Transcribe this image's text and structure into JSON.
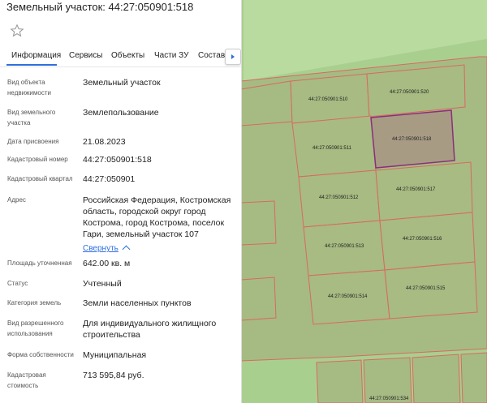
{
  "title": "Земельный участок: 44:27:050901:518",
  "tabs": [
    "Информация",
    "Сервисы",
    "Объекты",
    "Части ЗУ",
    "Состав"
  ],
  "fields": {
    "object_type": {
      "label": "Вид объекта недвижимости",
      "value": "Земельный участок"
    },
    "land_type": {
      "label": "Вид земельного участка",
      "value": "Землепользование"
    },
    "assign_date": {
      "label": "Дата присвоения",
      "value": "21.08.2023"
    },
    "cad_number": {
      "label": "Кадастровый номер",
      "value": "44:27:050901:518"
    },
    "cad_block": {
      "label": "Кадастровый квартал",
      "value": "44:27:050901"
    },
    "address": {
      "label": "Адрес",
      "value": "Российская Федерация, Костромская область, городской округ город Кострома, город Кострома, поселок Гари, земельный участок 107",
      "collapse": "Свернуть"
    },
    "area": {
      "label": "Площадь уточненная",
      "value": "642.00 кв. м"
    },
    "status": {
      "label": "Статус",
      "value": "Учтенный"
    },
    "category": {
      "label": "Категория земель",
      "value": "Земли населенных пунктов"
    },
    "permitted_use": {
      "label": "Вид разрешенного использования",
      "value": "Для индивидуального жилищного строительства"
    },
    "ownership": {
      "label": "Форма собственности",
      "value": "Муниципальная"
    },
    "cad_value": {
      "label": "Кадастровая стоимость",
      "value": "713 595,84 руб."
    }
  },
  "map": {
    "parcel_labels": [
      "44:27:050901:510",
      "44:27:050901:520",
      "44:27:050901:511",
      "44:27:050901:518",
      "44:27:050901:512",
      "44:27:050901:517",
      "44:27:050901:513",
      "44:27:050901:516",
      "44:27:050901:514",
      "44:27:050901:515",
      "44:27:050901:534"
    ],
    "colors": {
      "background": "#a9cf8f",
      "parcel_fill": "#a7bb82",
      "parcel_border": "#d9695f",
      "selected_fill": "#a89b84",
      "selected_border": "#8a2f7c"
    }
  }
}
